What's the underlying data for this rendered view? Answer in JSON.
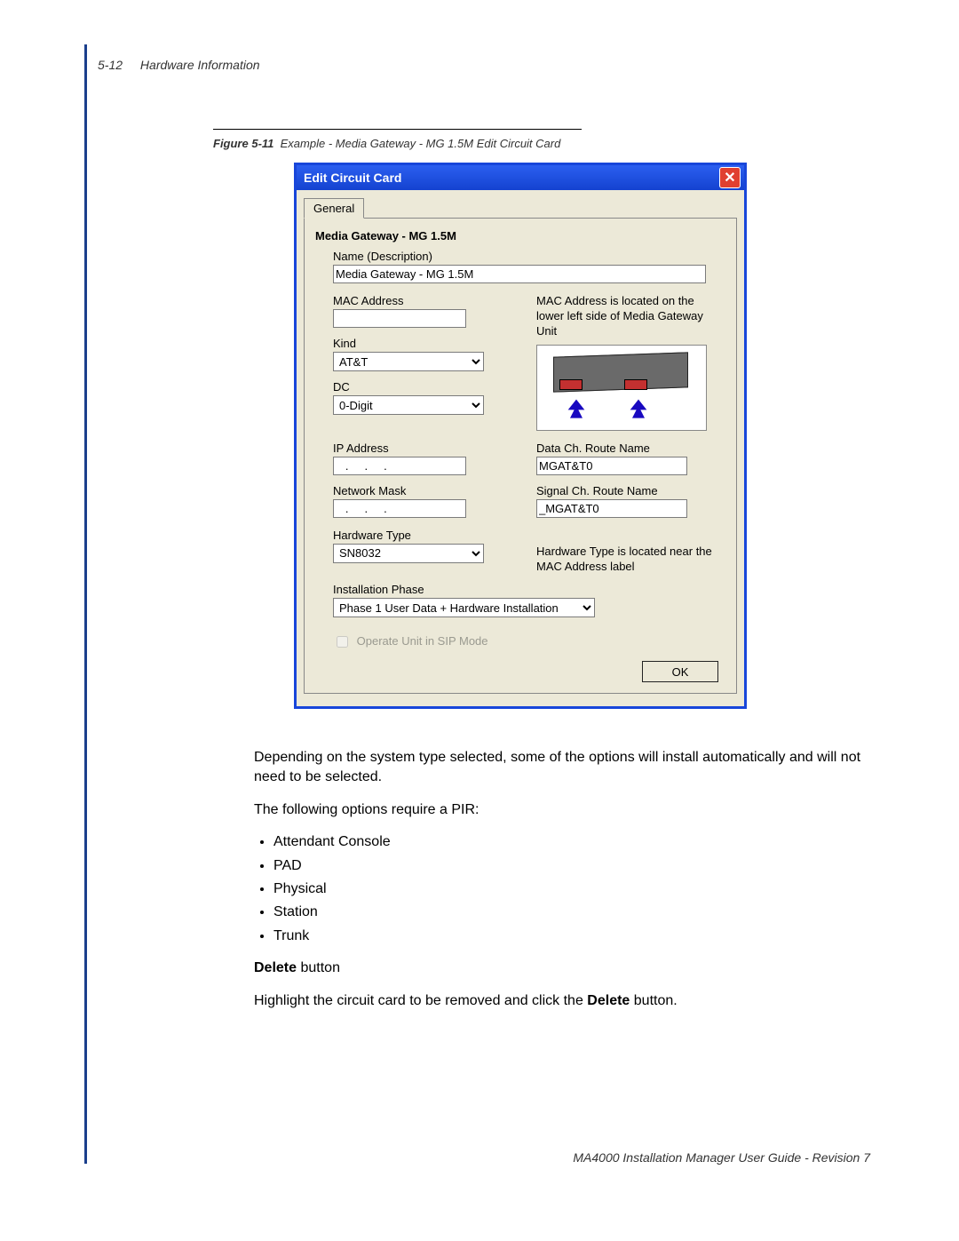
{
  "page": {
    "number": "5-12",
    "section": "Hardware Information",
    "footer": "MA4000 Installation Manager User Guide - Revision 7"
  },
  "figure": {
    "label": "Figure 5-11",
    "caption": "Example - Media Gateway - MG 1.5M Edit Circuit Card"
  },
  "dialog": {
    "title": "Edit Circuit Card",
    "tab": "General",
    "section_title": "Media Gateway - MG 1.5M",
    "fields": {
      "name_label": "Name (Description)",
      "name_value": "Media Gateway - MG 1.5M",
      "mac_label": "MAC Address",
      "mac_value": "",
      "mac_hint": "MAC Address is located on the lower left side of Media Gateway Unit",
      "kind_label": "Kind",
      "kind_value": "AT&T",
      "dc_label": "DC",
      "dc_value": "0-Digit",
      "ip_label": "IP Address",
      "ip_value": "   .     .     .   ",
      "mask_label": "Network Mask",
      "mask_value": "   .     .     .   ",
      "datach_label": "Data Ch. Route Name",
      "datach_value": "MGAT&T0",
      "sigch_label": "Signal Ch. Route Name",
      "sigch_value": "_MGAT&T0",
      "hwtype_label": "Hardware Type",
      "hwtype_value": "SN8032",
      "hwtype_hint": "Hardware Type is located near the MAC Address label",
      "phase_label": "Installation Phase",
      "phase_value": "Phase 1 User Data + Hardware Installation",
      "sip_label": "Operate Unit in SIP Mode"
    },
    "ok": "OK"
  },
  "body": {
    "para1": "Depending on the system type selected, some of the options will install automatically and will not need to be selected.",
    "para2": "The following options require a PIR:",
    "items": {
      "i1": "Attendant Console",
      "i2": "PAD",
      "i3": "Physical",
      "i4": "Station",
      "i5": "Trunk"
    },
    "delete_head_bold": "Delete",
    "delete_head_rest": " button",
    "delete_text_pre": "Highlight the circuit card to be removed and click the ",
    "delete_text_bold": "Delete",
    "delete_text_post": " button."
  }
}
